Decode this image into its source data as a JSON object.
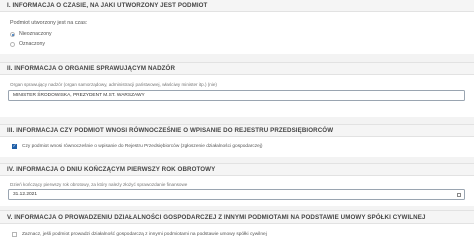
{
  "section1": {
    "header": "I. INFORMACJA O CZASIE, NA JAKI UTWORZONY JEST PODMIOT",
    "question": "Podmiot utworzony jest na czas:",
    "options": [
      "Nieoznaczony",
      "Oznaczony"
    ],
    "selected": "Nieoznaczony"
  },
  "section2": {
    "header": "II. INFORMACJA O ORGANIE SPRAWUJĄCYM NADZÓR",
    "field_label": "Organ sprawujący nadzór (organ samorządowy, administracji państwowej, właściwy minister itp.) (nie)",
    "field_value": "MINISTER ŚRODOWISKA, PREZYDENT M.ST. WARSZAWY"
  },
  "section3": {
    "header": "III. INFORMACJA CZY PODMIOT WNOSI RÓWNOCZEŚNIE O WPISANIE DO REJESTRU PRZEDSIĘBIORCÓW",
    "checkbox_label": "Czy podmiot wnosi równocześnie o wpisanie do Rejestru Przedsiębiorców (zgłoszenie działalności gospodarczej)",
    "checked": true
  },
  "section4": {
    "header": "IV. INFORMACJA O DNIU KOŃCZĄCYM PIERWSZY ROK OBROTOWY",
    "field_label": "Dzień kończący pierwszy rok obrotowy, za który należy złożyć sprawozdanie finansowe",
    "field_value": "31.12.2021"
  },
  "section5": {
    "header": "V. INFORMACJA O PROWADZENIU DZIAŁALNOŚCI GOSPODARCZEJ Z INNYMI PODMIOTAMI NA PODSTAWIE UMOWY SPÓŁKI CYWILNEJ",
    "checkbox_label": "Zaznacz, jeśli podmiot prowadzi działalność gospodarczą z innymi podmiotami na podstawie umowy spółki cywilnej",
    "checked": false
  },
  "colors": {
    "accent": "#1f5fa8",
    "header_bg": "#f5f5f5",
    "border": "#9aa5b1"
  }
}
